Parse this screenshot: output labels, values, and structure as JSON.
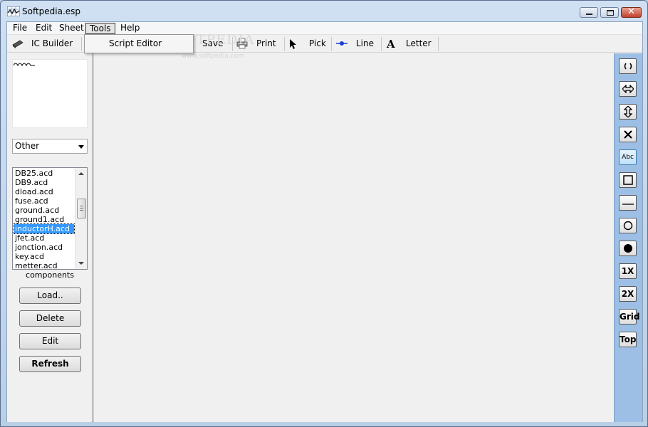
{
  "window": {
    "title": "Softpedia.esp"
  },
  "menu": [
    {
      "label": "File"
    },
    {
      "label": "Edit"
    },
    {
      "label": "Sheet"
    },
    {
      "label": "Tools"
    },
    {
      "label": "Help"
    }
  ],
  "toolbar": {
    "ic_builder": "IC Builder",
    "save": "Save",
    "print": "Print",
    "pick": "Pick",
    "line": "Line",
    "letter": "Letter"
  },
  "tools_dropdown": {
    "items": [
      "Script Editor"
    ]
  },
  "watermark": {
    "text": "SOFTPEDIA",
    "sub": "www.softpedia.com"
  },
  "left_panel": {
    "category_selected": "Other",
    "components_label": "components",
    "list_items": [
      "DB25.acd",
      "DB9.acd",
      "dload.acd",
      "fuse.acd",
      "ground.acd",
      "ground1.acd",
      "inductorH.acd",
      "jfet.acd",
      "jonction.acd",
      "key.acd",
      "metter.acd"
    ],
    "selected_index": 6,
    "buttons": {
      "load": "Load..",
      "delete": "Delete",
      "edit": "Edit",
      "refresh": "Refresh"
    }
  },
  "right_toolbar": {
    "abc": "Abc",
    "zoom1": "1X",
    "zoom2": "2X",
    "grid": "Grid",
    "top": "Top"
  },
  "colors": {
    "selection": "#3399ff",
    "right_bar": "#9dbfe6",
    "close_button": "#c2412b"
  }
}
